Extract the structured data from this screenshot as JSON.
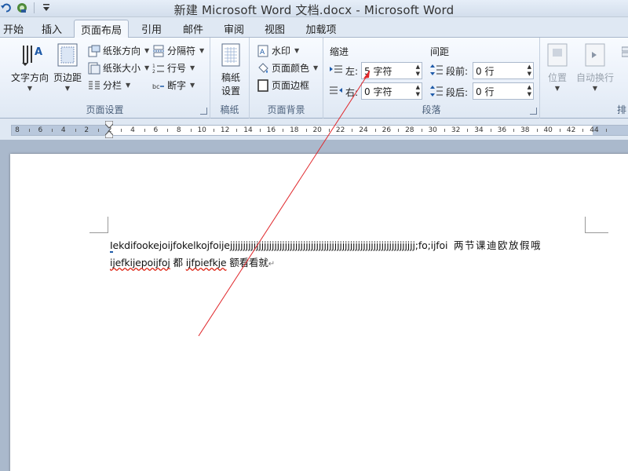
{
  "window": {
    "title": "新建 Microsoft Word 文档.docx - Microsoft Word"
  },
  "quick_access": {
    "icons": [
      "undo-icon",
      "redo-icon",
      "customize-icon"
    ]
  },
  "tabs": [
    {
      "label": "开始",
      "active": false
    },
    {
      "label": "插入",
      "active": false
    },
    {
      "label": "页面布局",
      "active": true
    },
    {
      "label": "引用",
      "active": false
    },
    {
      "label": "邮件",
      "active": false
    },
    {
      "label": "审阅",
      "active": false
    },
    {
      "label": "视图",
      "active": false
    },
    {
      "label": "加载项",
      "active": false
    }
  ],
  "ribbon": {
    "page_setup": {
      "label": "页面设置",
      "text_direction": "文字方向",
      "margins": "页边距",
      "orientation": "纸张方向",
      "size": "纸张大小",
      "columns": "分栏",
      "breaks": "分隔符",
      "line_numbers": "行号",
      "hyphenation": "断字"
    },
    "manuscript": {
      "label": "稿纸",
      "settings_line1": "稿纸",
      "settings_line2": "设置"
    },
    "page_background": {
      "label": "页面背景",
      "watermark": "水印",
      "page_color": "页面颜色",
      "page_borders": "页面边框"
    },
    "paragraph": {
      "label": "段落",
      "indent_title": "缩进",
      "spacing_title": "间距",
      "left_label": "左:",
      "left_value": "5 字符",
      "right_label": "右:",
      "right_value": "0 字符",
      "before_label": "段前:",
      "before_value": "0 行",
      "after_label": "段后:",
      "after_value": "0 行"
    },
    "arrange": {
      "position": "位置",
      "wrap": "自动换行",
      "partial": "排"
    }
  },
  "ruler": {
    "ticks": [
      "8",
      "6",
      "4",
      "2",
      "2",
      "4",
      "6",
      "8",
      "10",
      "12",
      "14",
      "16",
      "18",
      "20",
      "22",
      "24",
      "26",
      "28",
      "30",
      "32",
      "34",
      "36",
      "38",
      "40",
      "42",
      "44"
    ]
  },
  "document": {
    "line1_first": "I",
    "line1_rest": "ekdifookejoijfokelkojfoije",
    "line1_j": "jjjjjjjjjjjjjjjjjjjjjjjjjjjjjjjjjjjjjjjjjjjjjjjjjjjjjjjjjjjjjjjjjjjjjjj",
    "line1_tail": ";fo;ijfoi",
    "line1_chinese": "两节课迪欧放假哦",
    "line2_word1": "ijefkijepoijfoj",
    "line2_mid": " 都 ",
    "line2_word2": "ijfpiefkje",
    "line2_end": " 额看看就",
    "para_mark": "↵"
  },
  "colors": {
    "annotation_line": "#e0262a",
    "active_tab_bg": "#f4f8fd",
    "ribbon_bg": "#e7eef8"
  }
}
